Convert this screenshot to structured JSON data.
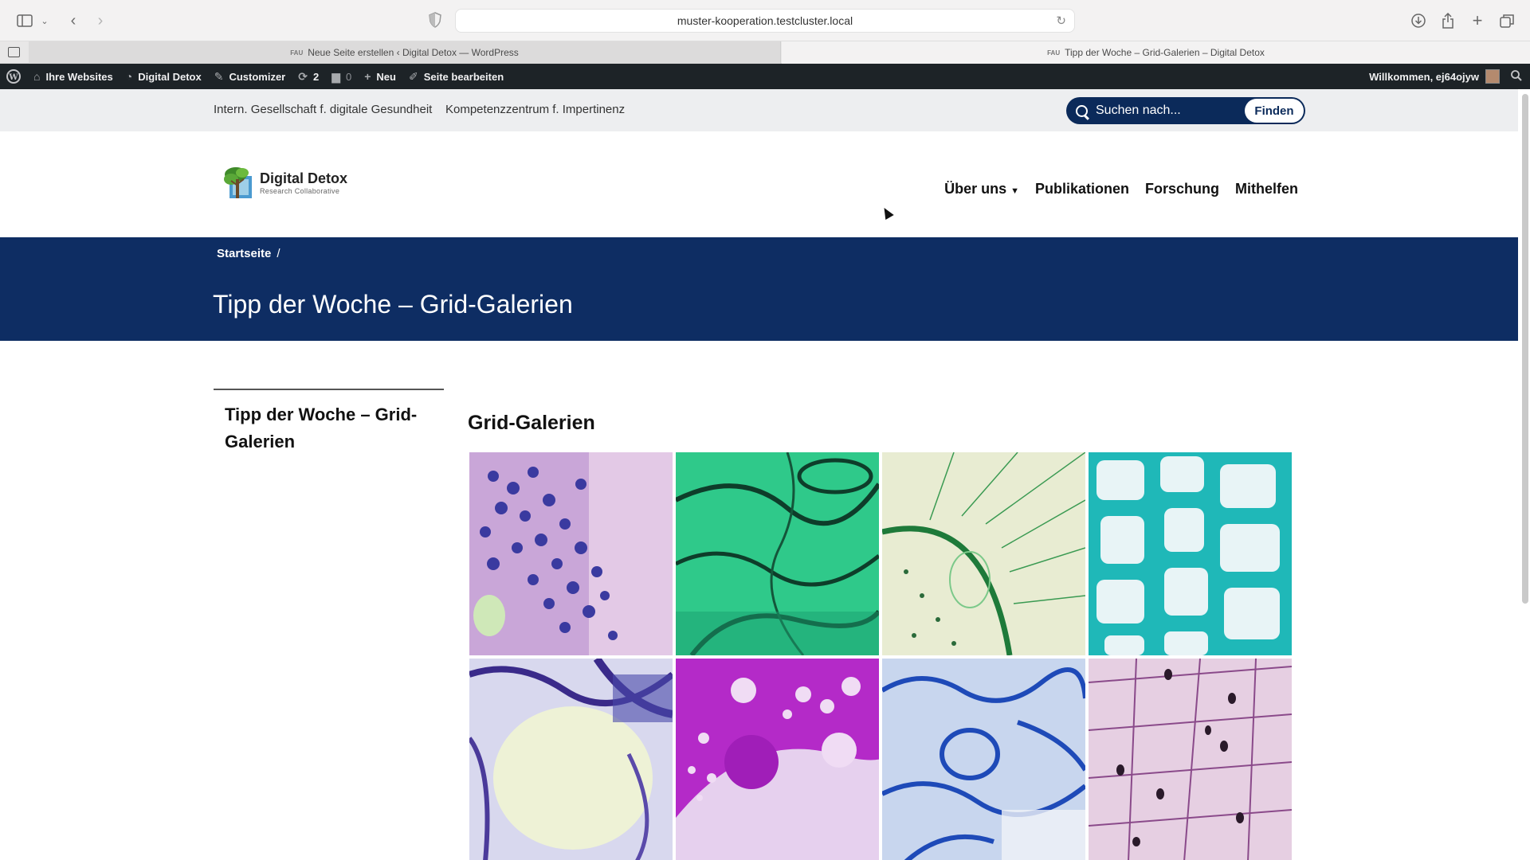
{
  "browser": {
    "url": "muster-kooperation.testcluster.local",
    "tabs": [
      {
        "label": "Neue Seite erstellen ‹ Digital Detox — WordPress",
        "favicon": "FAU",
        "active": false
      },
      {
        "label": "Tipp der Woche – Grid-Galerien – Digital Detox",
        "favicon": "FAU",
        "active": true
      }
    ]
  },
  "adminbar": {
    "items": [
      {
        "label": "Ihre Websites",
        "icon": "sites-icon"
      },
      {
        "label": "Digital Detox",
        "icon": "dashboard-icon"
      },
      {
        "label": "Customizer",
        "icon": "brush-icon"
      },
      {
        "label": "2",
        "icon": "updates-icon"
      },
      {
        "label": "0",
        "icon": "comments-icon"
      },
      {
        "label": "Neu",
        "icon": "plus-icon"
      },
      {
        "label": "Seite bearbeiten",
        "icon": "pencil-icon"
      }
    ],
    "greeting": "Willkommen, ej64ojyw"
  },
  "topbar": {
    "links": [
      "Intern. Gesellschaft f. digitale Gesundheit",
      "Kompetenzzentrum f. Impertinenz"
    ],
    "search_placeholder": "Suchen nach...",
    "search_button": "Finden"
  },
  "header": {
    "logo_name": "Digital Detox",
    "logo_sub": "Research Collaborative",
    "nav": [
      "Über uns",
      "Publikationen",
      "Forschung",
      "Mithelfen"
    ]
  },
  "hero": {
    "breadcrumb": "Startseite",
    "breadcrumb_sep": "/",
    "title": "Tipp der Woche – Grid-Galerien"
  },
  "sidebar": {
    "title": "Tipp der Woche – Grid-Galerien"
  },
  "content": {
    "section_title": "Grid-Galerien"
  },
  "colors": {
    "hero_bg": "#0e2d63",
    "admin_bar": "#1d2327",
    "search_bg": "#0b2a5a"
  }
}
